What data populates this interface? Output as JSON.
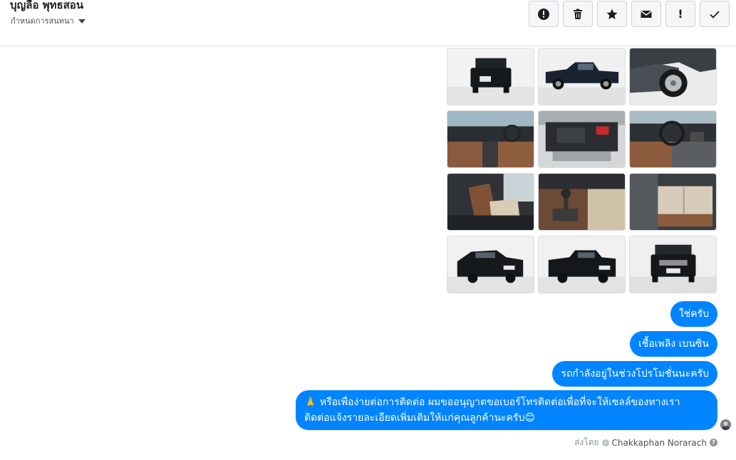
{
  "header": {
    "contact_name": "บุญลือ พุทธสอน",
    "settings_label": "กำหนดการสนทนา"
  },
  "toolbar": {
    "buttons": [
      {
        "name": "spam",
        "icon": "alert-circle-icon"
      },
      {
        "name": "delete",
        "icon": "trash-icon"
      },
      {
        "name": "star",
        "icon": "star-icon"
      },
      {
        "name": "mark-unread",
        "icon": "envelope-icon"
      },
      {
        "name": "important",
        "label": "!",
        "icon": "exclamation-icon"
      },
      {
        "name": "done",
        "icon": "check-icon"
      }
    ]
  },
  "photos": [
    {
      "desc": "truck-rear"
    },
    {
      "desc": "truck-side"
    },
    {
      "desc": "truck-wheel"
    },
    {
      "desc": "interior-dashboard"
    },
    {
      "desc": "engine-bay"
    },
    {
      "desc": "steering-wheel"
    },
    {
      "desc": "front-seats"
    },
    {
      "desc": "gear-shift"
    },
    {
      "desc": "rear-seats"
    },
    {
      "desc": "truck-front-quarter"
    },
    {
      "desc": "truck-rear-quarter"
    },
    {
      "desc": "truck-front"
    }
  ],
  "messages": [
    {
      "text": "ใช่ครับ"
    },
    {
      "text": "เชื้อเพลิง เบนซิน"
    },
    {
      "text": "รถกำลังอยู่ในช่วงโปรโมชั่นนะครับ"
    },
    {
      "text_line1": "🙏 หรือเพื่อง่ายต่อการติดต่อ ผมขออนุญาตขอเบอร์โทรติดต่อเพื่อที่จะให้เซลล์ของทางเรา",
      "text_line2": "ติดต่อแจ้งรายละเอียดเพิ่มเติมให้แก่คุณลูกค้านะครับ😊"
    }
  ],
  "footer": {
    "sent_by_label": "ส่งโดย",
    "sender_name": "Chakkaphan Norarach",
    "help_label": "?"
  },
  "colors": {
    "bubble": "#0084ff",
    "divider": "#dadde1"
  }
}
